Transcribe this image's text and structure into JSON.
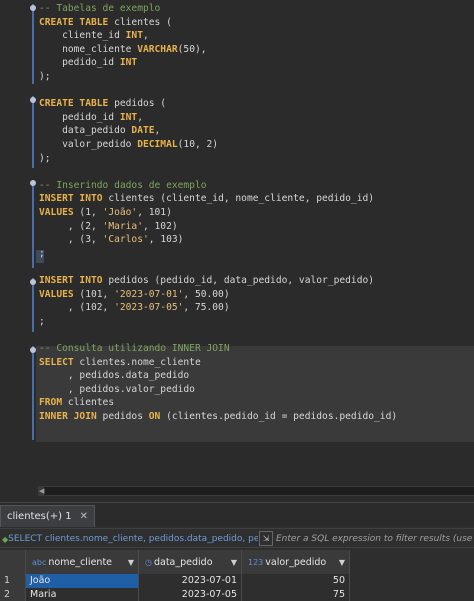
{
  "editor": {
    "lines": [
      [
        [
          "cm",
          "-- Tabelas de exemplo"
        ]
      ],
      [
        [
          "kw",
          "CREATE TABLE"
        ],
        [
          "id",
          " clientes ("
        ]
      ],
      [
        [
          "id",
          "    cliente_id "
        ],
        [
          "kw",
          "INT"
        ],
        [
          "p",
          ","
        ]
      ],
      [
        [
          "id",
          "    nome_cliente "
        ],
        [
          "kw",
          "VARCHAR"
        ],
        [
          "p",
          "(50),"
        ]
      ],
      [
        [
          "id",
          "    pedido_id "
        ],
        [
          "kw",
          "INT"
        ]
      ],
      [
        [
          "p",
          ");"
        ]
      ],
      [
        [
          "p",
          ""
        ]
      ],
      [
        [
          "kw",
          "CREATE TABLE"
        ],
        [
          "id",
          " pedidos ("
        ]
      ],
      [
        [
          "id",
          "    pedido_id "
        ],
        [
          "kw",
          "INT"
        ],
        [
          "p",
          ","
        ]
      ],
      [
        [
          "id",
          "    data_pedido "
        ],
        [
          "kw",
          "DATE"
        ],
        [
          "p",
          ","
        ]
      ],
      [
        [
          "id",
          "    valor_pedido "
        ],
        [
          "kw",
          "DECIMAL"
        ],
        [
          "p",
          "(10, 2)"
        ]
      ],
      [
        [
          "p",
          ");"
        ]
      ],
      [
        [
          "p",
          ""
        ]
      ],
      [
        [
          "cm",
          "-- Inserindo dados de exemplo"
        ]
      ],
      [
        [
          "kw",
          "INSERT INTO"
        ],
        [
          "id",
          " clientes (cliente_id, nome_cliente, pedido_id)"
        ]
      ],
      [
        [
          "kw",
          "VALUES"
        ],
        [
          "p",
          " (1, "
        ],
        [
          "str",
          "'João'"
        ],
        [
          "p",
          ", 101)"
        ]
      ],
      [
        [
          "p",
          "     , (2, "
        ],
        [
          "str",
          "'Maria'"
        ],
        [
          "p",
          ", 102)"
        ]
      ],
      [
        [
          "p",
          "     , (3, "
        ],
        [
          "str",
          "'Carlos'"
        ],
        [
          "p",
          ", 103)"
        ]
      ],
      [
        [
          "p",
          ";"
        ]
      ],
      [
        [
          "p",
          ""
        ]
      ],
      [
        [
          "kw",
          "INSERT INTO"
        ],
        [
          "id",
          " pedidos (pedido_id, data_pedido, valor_pedido)"
        ]
      ],
      [
        [
          "kw",
          "VALUES"
        ],
        [
          "p",
          " (101, "
        ],
        [
          "str",
          "'2023-07-01'"
        ],
        [
          "p",
          ", 50.00)"
        ]
      ],
      [
        [
          "p",
          "     , (102, "
        ],
        [
          "str",
          "'2023-07-05'"
        ],
        [
          "p",
          ", 75.00)"
        ]
      ],
      [
        [
          "p",
          ";"
        ]
      ],
      [
        [
          "p",
          ""
        ]
      ],
      [
        [
          "cm",
          "-- Consulta utilizando INNER JOIN"
        ]
      ],
      [
        [
          "kw",
          "SELECT"
        ],
        [
          "id",
          " clientes.nome_cliente"
        ]
      ],
      [
        [
          "id",
          "     , pedidos.data_pedido"
        ]
      ],
      [
        [
          "id",
          "     , pedidos.valor_pedido"
        ]
      ],
      [
        [
          "kw",
          "FROM"
        ],
        [
          "id",
          " clientes"
        ]
      ],
      [
        [
          "kw",
          "INNER JOIN"
        ],
        [
          "id",
          " pedidos "
        ],
        [
          "kw",
          "ON"
        ],
        [
          "id",
          " (clientes.pedido_id = pedidos.pedido_id)"
        ]
      ]
    ]
  },
  "results": {
    "tab_label": "clientes(+) 1",
    "tab_close": "✕",
    "filter_sql": "SELECT clientes.nome_cliente, pedidos.data_pedido, pedic",
    "filter_placeholder": "Enter a SQL expression to filter results (use Ctrl",
    "columns": [
      {
        "type_icon": "abc",
        "name": "nome_cliente"
      },
      {
        "type_icon": "◷",
        "name": "data_pedido"
      },
      {
        "type_icon": "123",
        "name": "valor_pedido"
      }
    ],
    "rows": [
      {
        "n": "1",
        "nome_cliente": "João",
        "data_pedido": "2023-07-01",
        "valor_pedido": "50"
      },
      {
        "n": "2",
        "nome_cliente": "Maria",
        "data_pedido": "2023-07-05",
        "valor_pedido": "75"
      }
    ]
  }
}
